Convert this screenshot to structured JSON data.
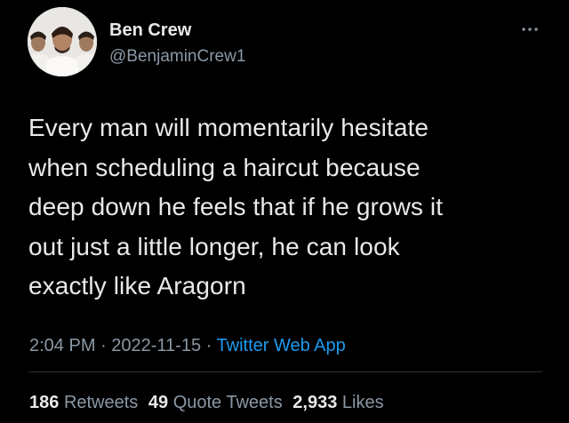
{
  "author": {
    "name": "Ben Crew",
    "handle": "@BenjaminCrew1",
    "avatar_icon": "avatar-photo"
  },
  "tweet": {
    "lines": [
      "Every man will momentarily hesitate",
      "when scheduling a haircut because",
      "deep down he feels that if he grows it",
      "out just a little longer, he can look",
      "exactly like Aragorn"
    ]
  },
  "meta": {
    "time": "2:04 PM",
    "separator": " · ",
    "date": "2022-11-15",
    "source": "Twitter Web App"
  },
  "stats": {
    "retweets_count": "186",
    "retweets_label": "Retweets",
    "quotes_count": "49",
    "quotes_label": "Quote Tweets",
    "likes_count": "2,933",
    "likes_label": "Likes"
  },
  "colors": {
    "background": "#000000",
    "primary_text": "#e7e9ea",
    "secondary_text": "#8b98a5",
    "link": "#1d9bf0"
  },
  "icons": {
    "more": "more-horizontal-icon"
  }
}
